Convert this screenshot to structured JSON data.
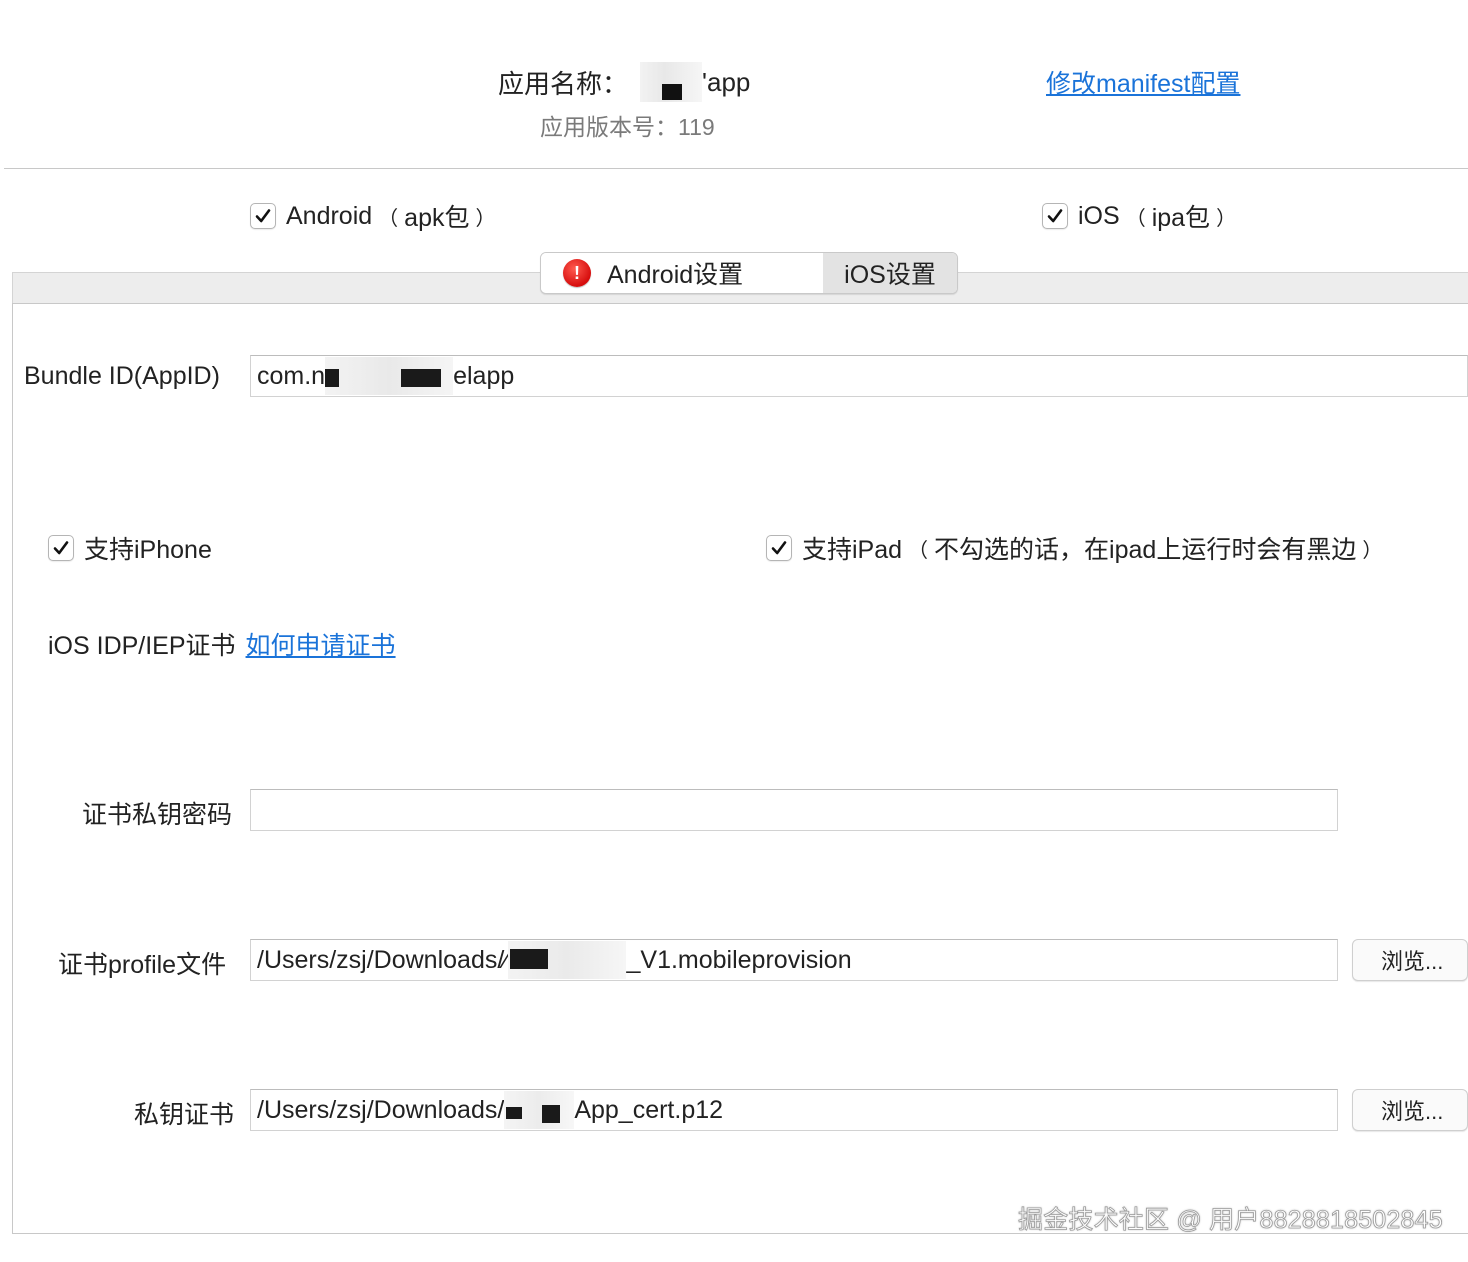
{
  "header": {
    "app_name_label": "应用名称：",
    "app_name_suffix": "'app",
    "version_label": "应用版本号：119",
    "manifest_link": "修改manifest配置"
  },
  "platforms": {
    "android": {
      "checked": true,
      "name": "Android",
      "open": "（",
      "pkg": "apk包",
      "close": "）"
    },
    "ios": {
      "checked": true,
      "name": "iOS",
      "open": "（",
      "pkg": "ipa包",
      "close": "）"
    }
  },
  "tabs": [
    {
      "label": "Android设置",
      "icon": "warning-icon",
      "icon_char": "!"
    },
    {
      "label": "iOS设置",
      "selected": true
    }
  ],
  "form": {
    "bundle_id_label": "Bundle ID(AppID)",
    "bundle_id_prefix": "com.n",
    "bundle_id_suffix": "elapp",
    "support_iphone": {
      "checked": true,
      "label": "支持iPhone"
    },
    "support_ipad": {
      "checked": true,
      "label": "支持iPad",
      "open": "（",
      "note": "不勾选的话，在ipad上运行时会有黑边",
      "close": "）"
    },
    "cert_section_label": "iOS IDP/IEP证书",
    "cert_help_link": "如何申请证书",
    "key_password_label": "证书私钥密码",
    "key_password_value": "",
    "profile_label": "证书profile文件",
    "profile_prefix": "/Users/zsj/Downloads/⁄",
    "profile_suffix": "_V1.mobileprovision",
    "private_key_label": "私钥证书",
    "private_key_prefix": "/Users/zsj/Downloads/",
    "private_key_suffix": "App_cert.p12",
    "browse_label": "浏览..."
  },
  "watermark": "掘金技术社区 @ 用户8828818502845",
  "colors": {
    "link": "#1a73d9",
    "warning": "#d60d0d",
    "tab_selected_bg": "#e3e3e3"
  }
}
